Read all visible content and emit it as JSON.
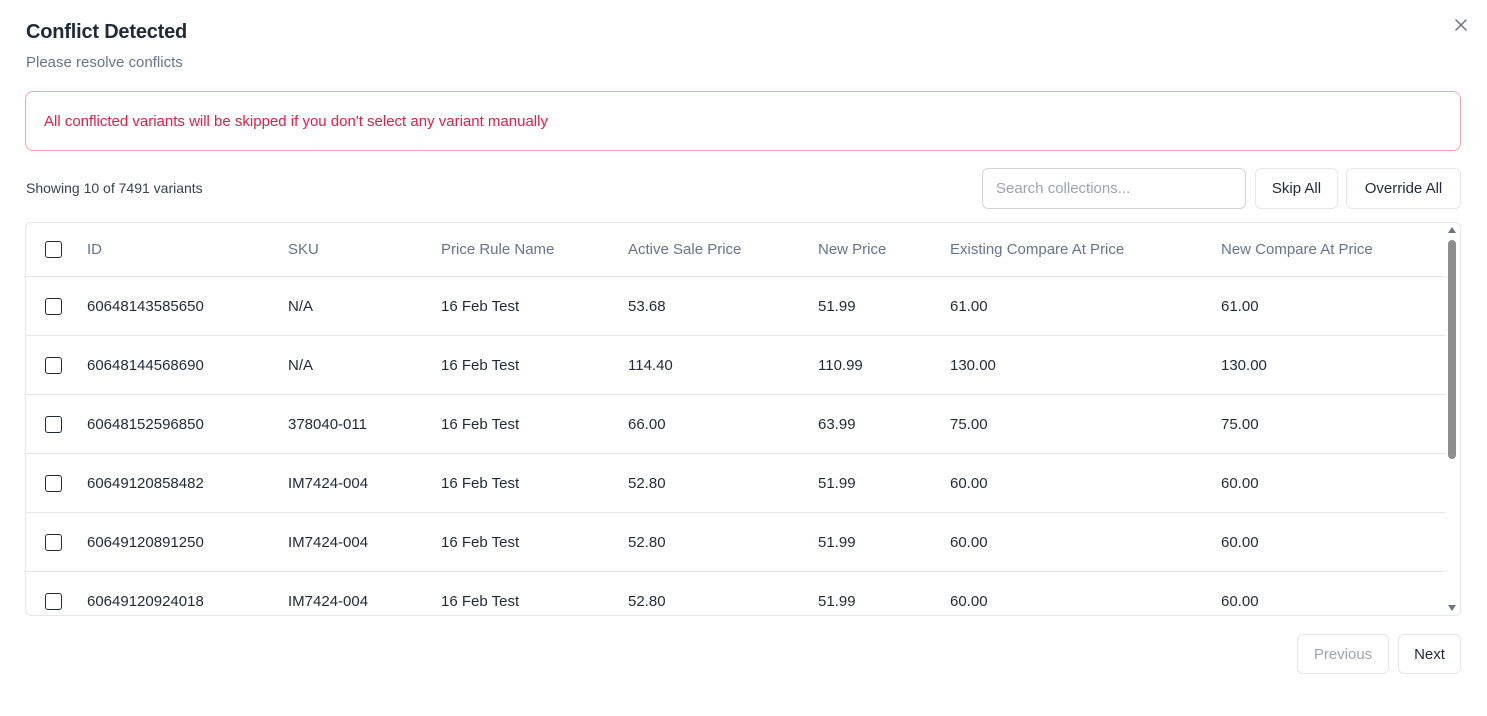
{
  "dialog": {
    "title": "Conflict Detected",
    "subtitle": "Please resolve conflicts",
    "alert": "All conflicted variants will be skipped if you don't select any variant manually",
    "count_text": "Showing 10 of 7491 variants"
  },
  "toolbar": {
    "search_placeholder": "Search collections...",
    "search_value": "",
    "skip_all_label": "Skip All",
    "override_all_label": "Override All"
  },
  "table": {
    "columns": [
      "ID",
      "SKU",
      "Price Rule Name",
      "Active Sale Price",
      "New Price",
      "Existing Compare At Price",
      "New Compare At Price"
    ],
    "rows": [
      {
        "id": "60648143585650",
        "sku": "N/A",
        "rule": "16 Feb Test",
        "active": "53.68",
        "new_price": "51.99",
        "existing_compare": "61.00",
        "new_compare": "61.00"
      },
      {
        "id": "60648144568690",
        "sku": "N/A",
        "rule": "16 Feb Test",
        "active": "114.40",
        "new_price": "110.99",
        "existing_compare": "130.00",
        "new_compare": "130.00"
      },
      {
        "id": "60648152596850",
        "sku": "378040-011",
        "rule": "16 Feb Test",
        "active": "66.00",
        "new_price": "63.99",
        "existing_compare": "75.00",
        "new_compare": "75.00"
      },
      {
        "id": "60649120858482",
        "sku": "IM7424-004",
        "rule": "16 Feb Test",
        "active": "52.80",
        "new_price": "51.99",
        "existing_compare": "60.00",
        "new_compare": "60.00"
      },
      {
        "id": "60649120891250",
        "sku": "IM7424-004",
        "rule": "16 Feb Test",
        "active": "52.80",
        "new_price": "51.99",
        "existing_compare": "60.00",
        "new_compare": "60.00"
      },
      {
        "id": "60649120924018",
        "sku": "IM7424-004",
        "rule": "16 Feb Test",
        "active": "52.80",
        "new_price": "51.99",
        "existing_compare": "60.00",
        "new_compare": "60.00"
      }
    ]
  },
  "pagination": {
    "previous_label": "Previous",
    "next_label": "Next"
  },
  "colors": {
    "alert_border": "#f4a3b5",
    "alert_text": "#e11d48",
    "muted_text": "#64748b"
  },
  "icons": {
    "close": "close-icon"
  }
}
